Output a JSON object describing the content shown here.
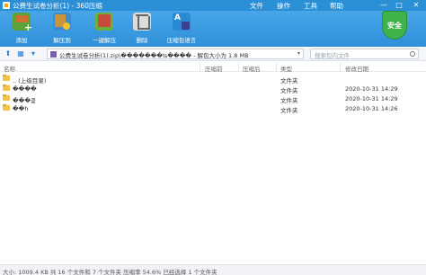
{
  "window": {
    "title": "公费生试卷分析(1) - 360压缩",
    "menus": [
      "文件",
      "操作",
      "工具",
      "帮助"
    ],
    "controls": [
      "—",
      "□",
      "✕"
    ]
  },
  "toolbar": {
    "items": [
      {
        "label": "添加",
        "icon": "add-archive-icon"
      },
      {
        "label": "解压到",
        "icon": "extract-to-icon"
      },
      {
        "label": "一键解压",
        "icon": "one-click-extract-icon"
      },
      {
        "label": "删除",
        "icon": "delete-icon"
      },
      {
        "label": "压缩包语言",
        "icon": "archive-language-icon"
      }
    ],
    "security_badge": "安全"
  },
  "address": {
    "path": "公费生试卷分析(1).zip\\�������ʦ���� - 解包大小为 1.8 MB",
    "search_placeholder": "搜索包内文件"
  },
  "columns": [
    "名称",
    "压缩前",
    "压缩后",
    "类型",
    "修改日期"
  ],
  "files": [
    {
      "name": ".. (上级目录)",
      "before": "",
      "after": "",
      "type": "文件夹",
      "date": ""
    },
    {
      "name": "����",
      "before": "",
      "after": "",
      "type": "文件夹",
      "date": "2020-10-31 14:29"
    },
    {
      "name": "���꼶",
      "before": "",
      "after": "",
      "type": "文件夹",
      "date": "2020-10-31 14:29"
    },
    {
      "name": "��h",
      "before": "",
      "after": "",
      "type": "文件夹",
      "date": "2020-10-31 14:26"
    }
  ],
  "status": "大小: 1009.4 KB 共 16 个文件和 7 个文件夹 压缩率 54.6% 已经选择 1 个文件夹"
}
